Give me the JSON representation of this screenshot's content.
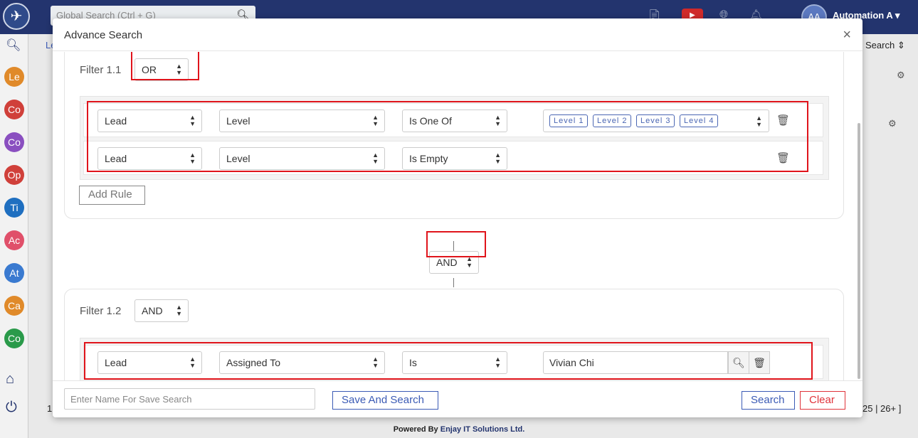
{
  "app": {
    "global_search_placeholder": "Global Search (Ctrl + G)",
    "user_initials": "AA",
    "user_name": "Automation A",
    "bg_breadcrumb": "Le",
    "bg_search_label": "Search",
    "bg_pager": "25 | 26+ ]",
    "bg_pager_left": "1",
    "footer_prefix": "Powered By ",
    "footer_brand": "Enjay IT Solutions Ltd.",
    "sidebar_modules": [
      {
        "abbr": "Le",
        "color": "#e08a2a"
      },
      {
        "abbr": "Co",
        "color": "#d0403a"
      },
      {
        "abbr": "Co",
        "color": "#8a4fc0"
      },
      {
        "abbr": "Op",
        "color": "#d0403a"
      },
      {
        "abbr": "Ti",
        "color": "#1f6fc0"
      },
      {
        "abbr": "Ac",
        "color": "#e0506a"
      },
      {
        "abbr": "At",
        "color": "#3a7ad0"
      },
      {
        "abbr": "Ca",
        "color": "#e08a2a"
      },
      {
        "abbr": "Co",
        "color": "#2a9a4a"
      }
    ]
  },
  "modal": {
    "title": "Advance Search",
    "close_symbol": "×",
    "filters": [
      {
        "label": "Filter 1.1",
        "operator": "OR",
        "rules": [
          {
            "module": "Lead",
            "field": "Level",
            "condition": "Is One Of",
            "values": [
              "Level 1",
              "Level 2",
              "Level 3",
              "Level 4"
            ]
          },
          {
            "module": "Lead",
            "field": "Level",
            "condition": "Is Empty"
          }
        ],
        "add_rule_label": "Add Rule"
      },
      {
        "label": "Filter 1.2",
        "operator": "AND",
        "rules": [
          {
            "module": "Lead",
            "field": "Assigned To",
            "condition": "Is",
            "value": "Vivian Chi"
          }
        ]
      }
    ],
    "group_connector": "AND",
    "footer": {
      "save_name_placeholder": "Enter Name For Save Search",
      "save_and_search_label": "Save And Search",
      "search_label": "Search",
      "clear_label": "Clear"
    }
  },
  "colors": {
    "topbar": "#23346e",
    "highlight_red": "#e0141b",
    "chip_blue": "#4a66b3",
    "clear_red": "#e0333a"
  }
}
